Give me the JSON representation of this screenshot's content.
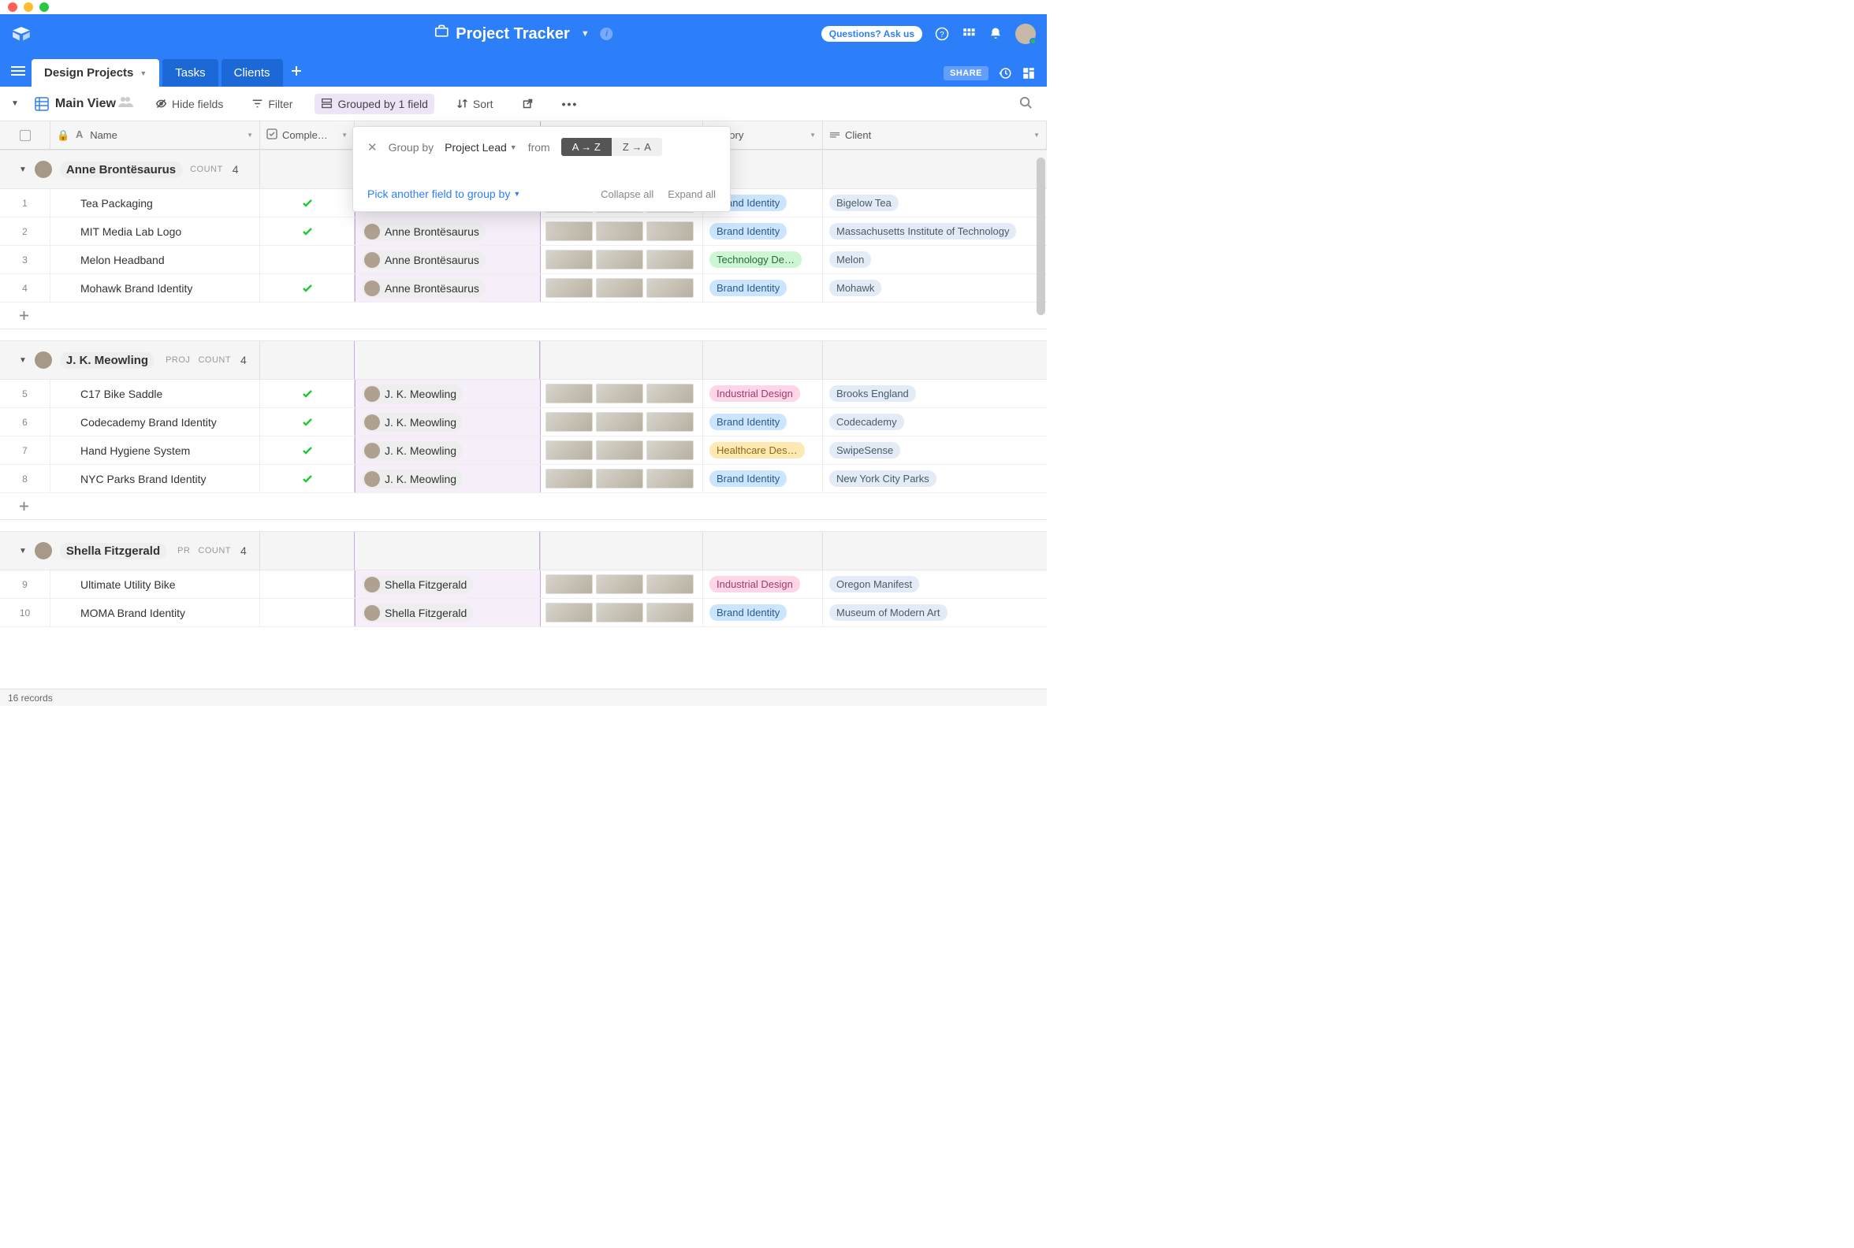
{
  "header": {
    "title": "Project Tracker",
    "ask_label": "Questions? Ask us"
  },
  "tabs": {
    "active": "Design Projects",
    "t1": "Tasks",
    "t2": "Clients"
  },
  "tabs_right": {
    "share": "SHARE"
  },
  "toolbar": {
    "view_name": "Main View",
    "hide_fields": "Hide fields",
    "filter": "Filter",
    "grouped": "Grouped by 1 field",
    "sort": "Sort"
  },
  "columns": {
    "name": "Name",
    "complete": "Comple…",
    "category": "ategory",
    "client": "Client"
  },
  "popup": {
    "group_by": "Group by",
    "field": "Project Lead",
    "from": "from",
    "sort_asc": "A → Z",
    "sort_desc": "Z → A",
    "pick": "Pick another field to group by",
    "collapse": "Collapse all",
    "expand": "Expand all"
  },
  "groups": [
    {
      "lead": "Anne Brontësaurus",
      "meta": "",
      "count_label": "COUNT",
      "count": "4",
      "rows": [
        {
          "n": "1",
          "name": "Tea Packaging",
          "complete": true,
          "cat": "Brand Identity",
          "cat_c": "blue",
          "client": "Bigelow Tea"
        },
        {
          "n": "2",
          "name": "MIT Media Lab Logo",
          "complete": true,
          "cat": "Brand Identity",
          "cat_c": "blue",
          "client": "Massachusetts Institute of Technology"
        },
        {
          "n": "3",
          "name": "Melon Headband",
          "complete": false,
          "cat": "Technology De…",
          "cat_c": "green",
          "client": "Melon"
        },
        {
          "n": "4",
          "name": "Mohawk Brand Identity",
          "complete": true,
          "cat": "Brand Identity",
          "cat_c": "blue",
          "client": "Mohawk"
        }
      ]
    },
    {
      "lead": "J. K. Meowling",
      "meta": "PROJ",
      "count_label": "COUNT",
      "count": "4",
      "rows": [
        {
          "n": "5",
          "name": "C17 Bike Saddle",
          "complete": true,
          "cat": "Industrial Design",
          "cat_c": "pink",
          "client": "Brooks England"
        },
        {
          "n": "6",
          "name": "Codecademy Brand Identity",
          "complete": true,
          "cat": "Brand Identity",
          "cat_c": "blue",
          "client": "Codecademy"
        },
        {
          "n": "7",
          "name": "Hand Hygiene System",
          "complete": true,
          "cat": "Healthcare Des…",
          "cat_c": "yellow",
          "client": "SwipeSense"
        },
        {
          "n": "8",
          "name": "NYC Parks Brand Identity",
          "complete": true,
          "cat": "Brand Identity",
          "cat_c": "blue",
          "client": "New York City Parks"
        }
      ]
    },
    {
      "lead": "Shella Fitzgerald",
      "meta": "PR",
      "count_label": "COUNT",
      "count": "4",
      "rows": [
        {
          "n": "9",
          "name": "Ultimate Utility Bike",
          "complete": false,
          "cat": "Industrial Design",
          "cat_c": "pink",
          "client": "Oregon Manifest"
        },
        {
          "n": "10",
          "name": "MOMA Brand Identity",
          "complete": false,
          "cat": "Brand Identity",
          "cat_c": "blue",
          "client": "Museum of Modern Art"
        }
      ]
    }
  ],
  "footer": {
    "records": "16 records"
  }
}
